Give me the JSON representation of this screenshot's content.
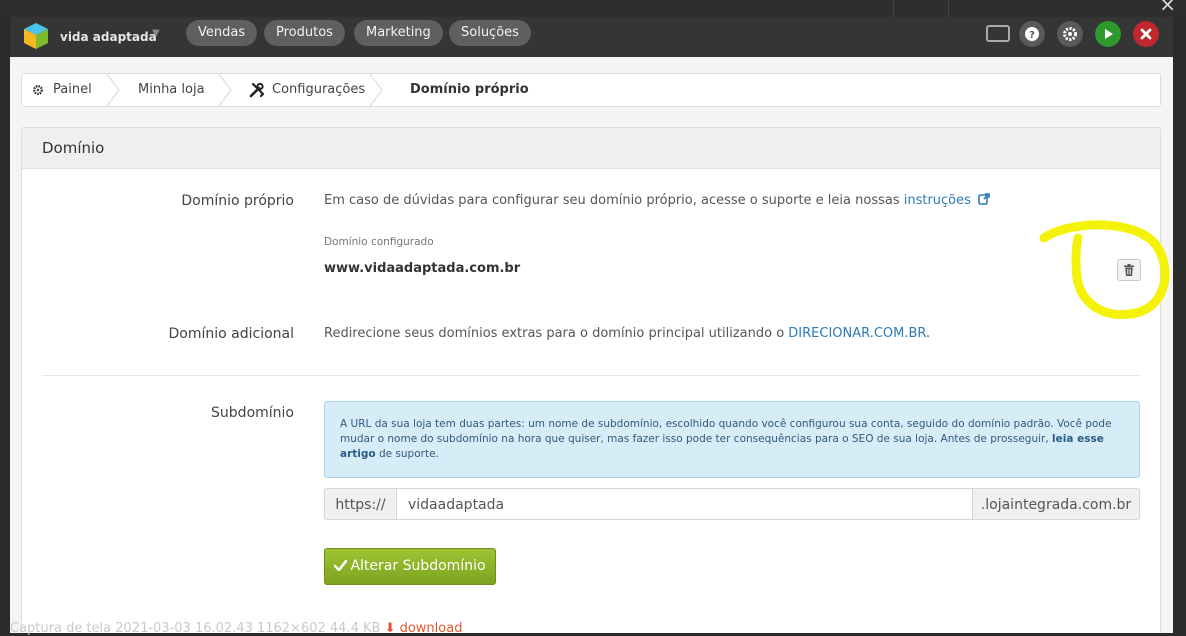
{
  "topbar": {
    "brand": "vida adaptada",
    "nav": [
      "Vendas",
      "Produtos",
      "Marketing",
      "Soluções"
    ],
    "colors": {
      "help": "#5a5a5a",
      "settings": "#5a5a5a",
      "play": "#2e9a2e",
      "close": "#c0282d"
    }
  },
  "breadcrumb": {
    "items": [
      "Painel",
      "Minha loja",
      "Configurações",
      "Domínio próprio"
    ]
  },
  "panel": {
    "title": "Domínio",
    "dominio_proprio": {
      "label": "Domínio próprio",
      "text": "Em caso de dúvidas para configurar seu domínio próprio, acesse o suporte e leia nossas ",
      "link": "instruções",
      "configured_label": "Domínio configurado",
      "configured_value": "www.vidaadaptada.com.br"
    },
    "dominio_adicional": {
      "label": "Domínio adicional",
      "text": "Redirecione seus domínios extras para o domínio principal utilizando o ",
      "link": "DIRECIONAR.COM.BR",
      "suffix": "."
    },
    "subdominio": {
      "label": "Subdomínio",
      "info_text": "A URL da sua loja tem duas partes: um nome de subdomínio, escolhido quando você configurou sua conta, seguido do domínio padrão. Você pode mudar o nome do subdomínio na hora que quiser, mas fazer isso pode ter consequências para o SEO de sua loja. Antes de prosseguir, ",
      "info_link": "leia esse artigo",
      "info_suffix": " de suporte.",
      "prefix": "https://",
      "value": "vidaadaptada",
      "suffix": ".lojaintegrada.com.br",
      "button": "Alterar Subdomínio"
    }
  },
  "caption": {
    "text": "Captura de tela 2021-03-03 16.02.43   1162×602 44.4 KB",
    "download": "download"
  },
  "annotation_color": "#f5f20a"
}
